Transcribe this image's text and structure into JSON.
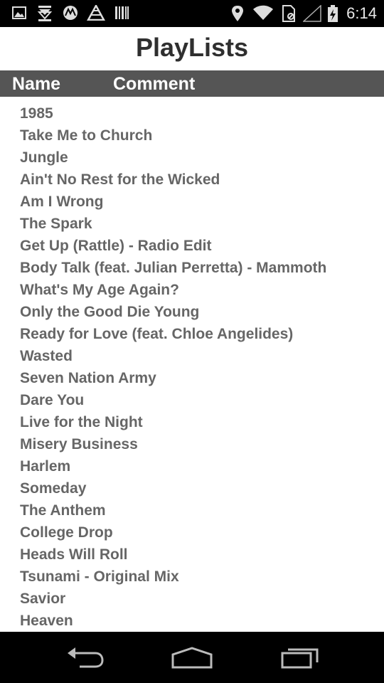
{
  "status_bar": {
    "time": "6:14",
    "icons": [
      "image-icon",
      "download-icon",
      "motorola-icon",
      "cell-tower-icon",
      "barcode-icon",
      "location-icon",
      "wifi-icon",
      "sim-icon",
      "signal-icon",
      "battery-icon"
    ]
  },
  "app": {
    "title": "PlayLists"
  },
  "table": {
    "columns": {
      "name": "Name",
      "comment": "Comment"
    },
    "rows": [
      "1985",
      "Take Me to Church",
      "Jungle",
      "Ain't No Rest for the Wicked",
      "Am I Wrong",
      "The Spark",
      "Get Up (Rattle) - Radio Edit",
      "Body Talk (feat. Julian Perretta) - Mammoth",
      "What's My Age Again?",
      "Only the Good Die Young",
      "Ready for Love (feat. Chloe Angelides)",
      "Wasted",
      "Seven Nation Army",
      "Dare You",
      "Live for the Night",
      "Misery Business",
      "Harlem",
      "Someday",
      "The Anthem",
      "College Drop",
      "Heads Will Roll",
      "Tsunami - Original Mix",
      "Savior",
      "Heaven"
    ]
  },
  "nav_bar": {
    "icons": [
      "back-icon",
      "home-icon",
      "recent-apps-icon"
    ]
  }
}
